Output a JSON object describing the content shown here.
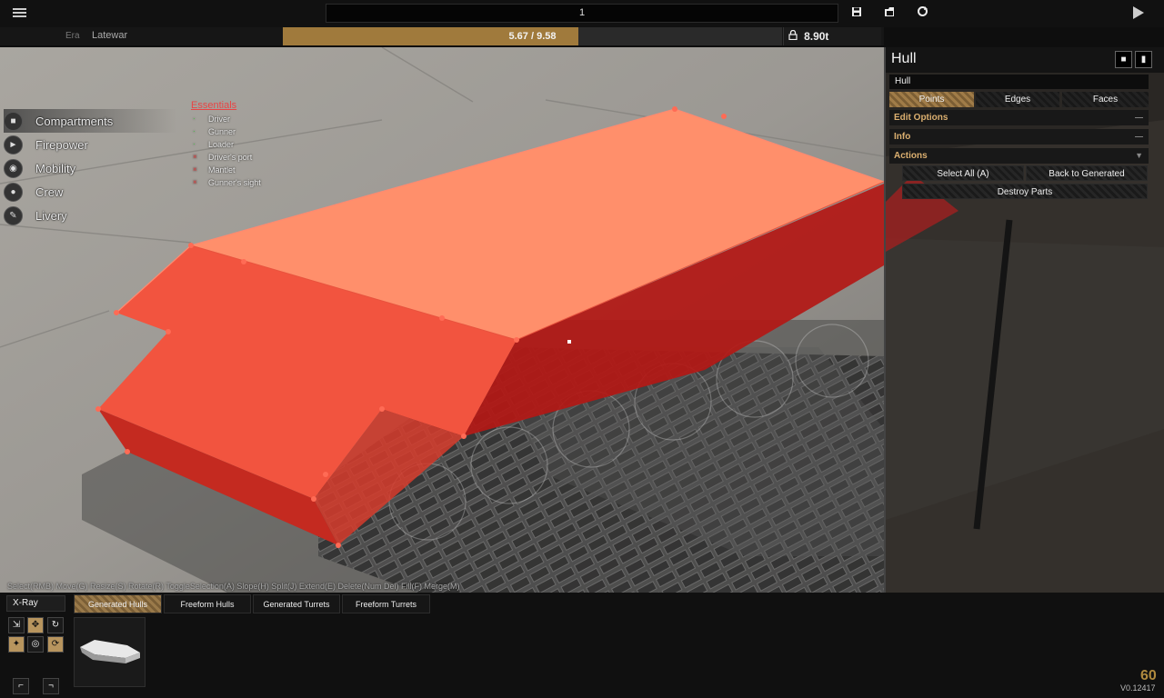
{
  "topbar": {
    "menu_icon": "hamburger-menu-icon",
    "title_value": "1",
    "icons": [
      "save-icon",
      "load-icon",
      "reset-icon"
    ],
    "play_icon": "play-icon"
  },
  "status": {
    "era_label": "Era",
    "era_value": "Latewar",
    "weight_text": "5.67 / 9.58",
    "weight_fraction": 0.592,
    "tonnage_text": "8.90t",
    "tonnage_icon": "lock-icon",
    "weight_color": "#a07a3c"
  },
  "nav": {
    "items": [
      {
        "label": "Compartments",
        "icon": "compartments-icon"
      },
      {
        "label": "Firepower",
        "icon": "firepower-icon"
      },
      {
        "label": "Mobility",
        "icon": "mobility-icon"
      },
      {
        "label": "Crew",
        "icon": "crew-icon"
      },
      {
        "label": "Livery",
        "icon": "livery-icon"
      }
    ]
  },
  "essentials": {
    "title": "Essentials",
    "items": [
      {
        "label": "Driver",
        "status": "ok"
      },
      {
        "label": "Gunner",
        "status": "ok"
      },
      {
        "label": "Loader",
        "status": "ok"
      },
      {
        "label": "Driver's port",
        "status": "missing"
      },
      {
        "label": "Mantlet",
        "status": "missing"
      },
      {
        "label": "Gunner's sight",
        "status": "missing"
      }
    ]
  },
  "hotkeys": "Select(RMB) Move(G) Resize(S) Rotate(R) ToggleSelection(A) Slope(H) Split(J) Extend(E) Delete(Num Del) Fill(F) Merge(M)",
  "panel": {
    "title": "Hull",
    "header_icons": [
      "save-icon",
      "load-icon"
    ],
    "name_value": "Hull",
    "modes": [
      "Points",
      "Edges",
      "Faces"
    ],
    "active_mode": "Points",
    "sections": [
      {
        "label": "Edit Options",
        "toggle": "—"
      },
      {
        "label": "Info",
        "toggle": "—"
      },
      {
        "label": "Actions",
        "toggle": "▼"
      }
    ],
    "actions": {
      "select_all": "Select All (A)",
      "back_to_generated": "Back to Generated",
      "destroy_parts": "Destroy Parts"
    }
  },
  "bottom": {
    "xray_label": "X-Ray",
    "tabs": [
      "Generated Hulls",
      "Freeform Hulls",
      "Generated Turrets",
      "Freeform Turrets"
    ],
    "active_tab": "Generated Hulls",
    "tools": [
      "scale-tool-icon",
      "move-tool-icon",
      "rotate-tool-icon",
      "snap-icon",
      "pivot-icon",
      "cycle-icon",
      "mirror-left-icon",
      "mirror-right-icon"
    ],
    "fps": "60",
    "version": "V0.12417"
  },
  "colors": {
    "hull_top": "#ff8f6b",
    "hull_side": "#f2543f",
    "hull_dark": "#b31815",
    "accent": "#a07a3c",
    "essential_ok": "#3bd13b",
    "essential_missing": "#e84545"
  }
}
